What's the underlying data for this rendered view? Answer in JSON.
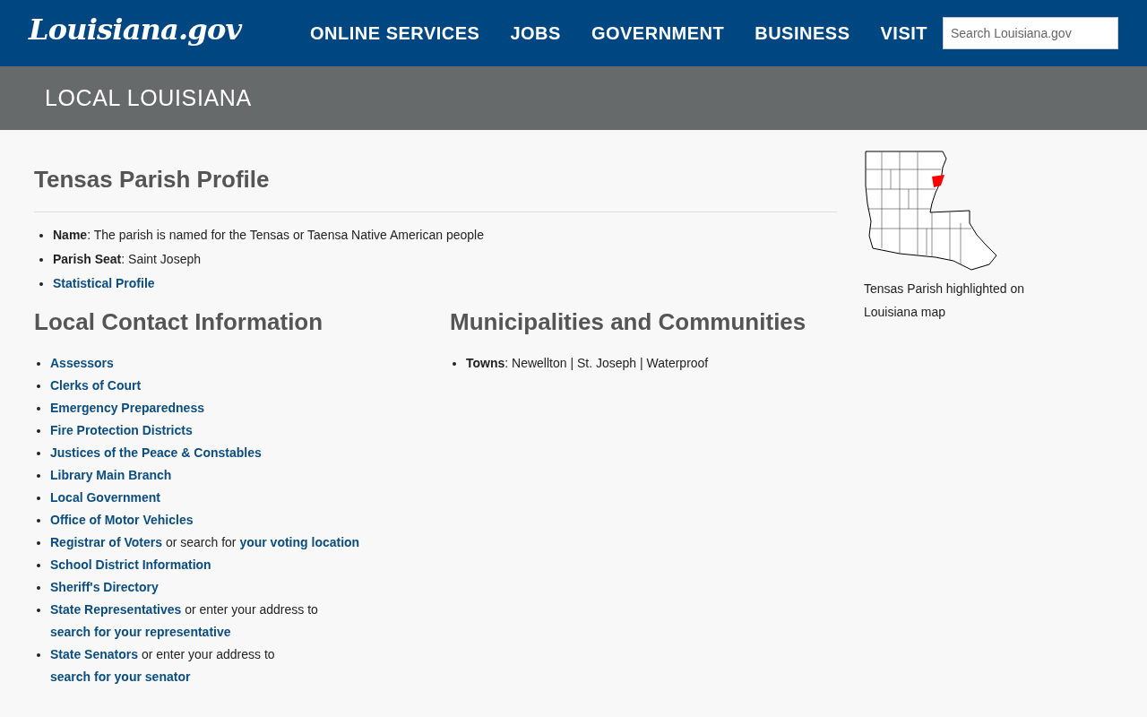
{
  "header": {
    "logo": "Louisiana.gov",
    "nav": [
      "ONLINE SERVICES",
      "JOBS",
      "GOVERNMENT",
      "BUSINESS",
      "VISIT"
    ],
    "search": {
      "placeholder": "Search Louisiana.gov"
    }
  },
  "banner": {
    "title": "LOCAL LOUISIANA"
  },
  "profile": {
    "title": "Tensas Parish Profile",
    "items": [
      {
        "kind": "text",
        "text": "**Name**: The parish is named for the Tensas or Taensa Native American people"
      },
      {
        "kind": "text",
        "text": "**Parish Seat**: Saint Joseph"
      },
      {
        "kind": "link",
        "text": "**Statistical Profile**"
      }
    ]
  },
  "contacts": {
    "title": "Local Contact Information",
    "items": [
      {
        "parts": [
          {
            "kind": "link",
            "text": "Assessors"
          }
        ]
      },
      {
        "parts": [
          {
            "kind": "link",
            "text": "Clerks of Court"
          }
        ]
      },
      {
        "parts": [
          {
            "kind": "link",
            "text": "Emergency Preparedness"
          }
        ]
      },
      {
        "parts": [
          {
            "kind": "link",
            "text": "Fire Protection Districts"
          }
        ]
      },
      {
        "parts": [
          {
            "kind": "link",
            "text": "Justices of the Peace & Constables"
          }
        ]
      },
      {
        "parts": [
          {
            "kind": "link",
            "text": "Library Main Branch"
          }
        ]
      },
      {
        "parts": [
          {
            "kind": "link",
            "text": "Local Government"
          }
        ]
      },
      {
        "parts": [
          {
            "kind": "link",
            "text": "Office of Motor Vehicles"
          }
        ]
      },
      {
        "parts": [
          {
            "kind": "link",
            "text": "Registrar of Voters"
          },
          {
            "kind": "plain",
            "text": " or search for "
          },
          {
            "kind": "link",
            "text": "your voting location"
          }
        ]
      },
      {
        "parts": [
          {
            "kind": "link",
            "text": "School District Information"
          }
        ]
      },
      {
        "parts": [
          {
            "kind": "link",
            "text": "Sheriff's Directory"
          }
        ]
      },
      {
        "parts": [
          {
            "kind": "link",
            "text": "State Representatives"
          },
          {
            "kind": "plain",
            "text": " or enter your address to "
          },
          {
            "kind": "link",
            "text": "search for your representative"
          }
        ]
      },
      {
        "parts": [
          {
            "kind": "link",
            "text": "State Senators"
          },
          {
            "kind": "plain",
            "text": " or enter your address to "
          },
          {
            "kind": "link",
            "text": "search for your senator"
          }
        ]
      }
    ]
  },
  "municipalities": {
    "title": "Municipalities and Communities",
    "items": [
      {
        "text": "**Towns**: Newellton | St. Joseph | Waterproof"
      }
    ]
  },
  "map": {
    "caption": "Tensas Parish highlighted on Louisiana map"
  }
}
